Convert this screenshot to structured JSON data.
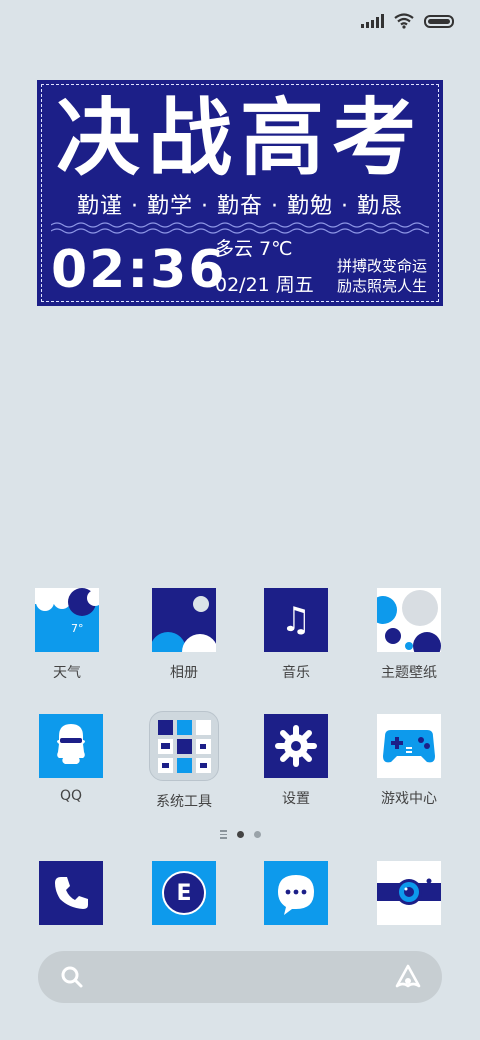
{
  "widget": {
    "title": "决战高考",
    "motto": "勤谨 · 勤学 · 勤奋 · 勤勉 · 勤恳",
    "time": "02:36",
    "weather": "多云  7℃",
    "date": "02/21 周五",
    "slogan_line1": "拼搏改变命运",
    "slogan_line2": "励志照亮人生"
  },
  "apps": [
    {
      "label": "天气",
      "icon": "weather-icon",
      "temp": "7°"
    },
    {
      "label": "相册",
      "icon": "gallery-icon"
    },
    {
      "label": "音乐",
      "icon": "music-icon",
      "glyph": "♫"
    },
    {
      "label": "主题壁纸",
      "icon": "themes-icon"
    },
    {
      "label": "QQ",
      "icon": "qq-icon"
    },
    {
      "label": "系统工具",
      "icon": "system-tools-folder-icon"
    },
    {
      "label": "设置",
      "icon": "settings-gear-icon"
    },
    {
      "label": "游戏中心",
      "icon": "game-controller-icon"
    }
  ],
  "dock": [
    {
      "icon": "phone-icon"
    },
    {
      "icon": "browser-e-icon",
      "letter": "E"
    },
    {
      "icon": "messages-icon"
    },
    {
      "icon": "camera-icon"
    }
  ],
  "page_indicator": {
    "pages": 2,
    "current": 1
  },
  "colors": {
    "navy": "#1c1f88",
    "blue": "#0d9aec",
    "background": "#dbe3e8"
  }
}
